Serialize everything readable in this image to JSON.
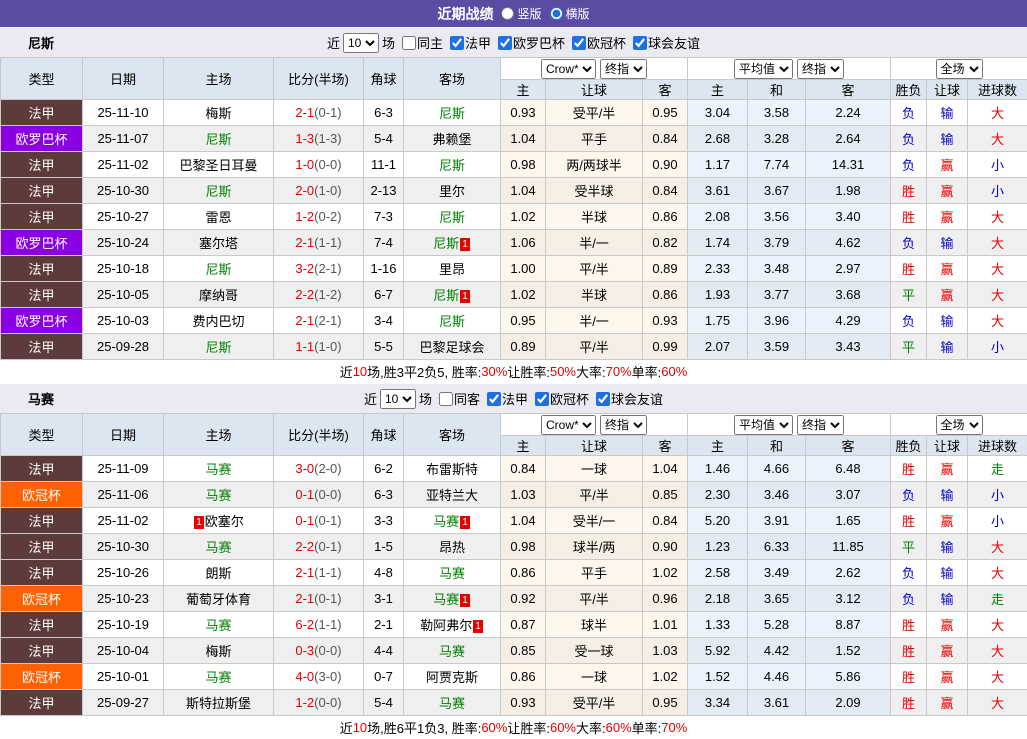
{
  "banner": {
    "title": "近期战绩",
    "vertical": "竖版",
    "horizontal": "横版"
  },
  "head": {
    "type": "类型",
    "date": "日期",
    "home": "主场",
    "score": "比分(半场)",
    "corner": "角球",
    "away": "客场",
    "h": "主",
    "rq": "让球",
    "a": "客",
    "draw": "和",
    "sf": "胜负",
    "goals": "进球数"
  },
  "dropdowns": {
    "crow": "Crow*",
    "final": "终指",
    "avg": "平均值",
    "full": "全场"
  },
  "filters_common": {
    "near": "近",
    "games": "场"
  },
  "colors": {
    "banner_bg": "#5b4ba2",
    "ligue1_bg": "#5e3b3b",
    "europa_bg": "#8b00e3",
    "ucl_bg": "#ff6000",
    "focus_team": "#008000",
    "score_red": "#e60000",
    "win_red": "#e60000",
    "draw_green": "#008000",
    "loss_blue": "#0000cc"
  },
  "sections": [
    {
      "team": "尼斯",
      "filter": {
        "count": "10",
        "same": "同主",
        "same_checked": false,
        "leagues": [
          "法甲",
          "欧罗巴杯",
          "欧冠杯",
          "球会友谊"
        ]
      },
      "rows": [
        {
          "lg": "法甲",
          "lc": "fa",
          "date": "25-11-10",
          "home": {
            "n": "梅斯"
          },
          "score": "2-1",
          "half": "(0-1)",
          "corner": "6-3",
          "away": {
            "n": "尼斯",
            "g": true
          },
          "o1": "0.93",
          "hd": "受平/半",
          "o2": "0.95",
          "a1": "3.04",
          "a2": "3.58",
          "a3": "2.24",
          "r1": {
            "t": "负",
            "c": "cb"
          },
          "r2": {
            "t": "输",
            "c": "cb"
          },
          "r3": {
            "t": "大",
            "c": "cr"
          }
        },
        {
          "lg": "欧罗巴杯",
          "lc": "ou",
          "date": "25-11-07",
          "home": {
            "n": "尼斯",
            "g": true
          },
          "score": "1-3",
          "half": "(1-3)",
          "corner": "5-4",
          "away": {
            "n": "弗赖堡"
          },
          "o1": "1.04",
          "hd": "平手",
          "o2": "0.84",
          "a1": "2.68",
          "a2": "3.28",
          "a3": "2.64",
          "r1": {
            "t": "负",
            "c": "cb"
          },
          "r2": {
            "t": "输",
            "c": "cb"
          },
          "r3": {
            "t": "大",
            "c": "cr"
          }
        },
        {
          "lg": "法甲",
          "lc": "fa",
          "date": "25-11-02",
          "home": {
            "n": "巴黎圣日耳曼"
          },
          "score": "1-0",
          "half": "(0-0)",
          "corner": "11-1",
          "away": {
            "n": "尼斯",
            "g": true
          },
          "o1": "0.98",
          "hd": "两/两球半",
          "o2": "0.90",
          "a1": "1.17",
          "a2": "7.74",
          "a3": "14.31",
          "r1": {
            "t": "负",
            "c": "cb"
          },
          "r2": {
            "t": "赢",
            "c": "cr"
          },
          "r3": {
            "t": "小",
            "c": "cb"
          }
        },
        {
          "lg": "法甲",
          "lc": "fa",
          "date": "25-10-30",
          "home": {
            "n": "尼斯",
            "g": true
          },
          "score": "2-0",
          "half": "(1-0)",
          "corner": "2-13",
          "away": {
            "n": "里尔"
          },
          "o1": "1.04",
          "hd": "受半球",
          "o2": "0.84",
          "a1": "3.61",
          "a2": "3.67",
          "a3": "1.98",
          "r1": {
            "t": "胜",
            "c": "cr"
          },
          "r2": {
            "t": "赢",
            "c": "cr"
          },
          "r3": {
            "t": "小",
            "c": "cb"
          }
        },
        {
          "lg": "法甲",
          "lc": "fa",
          "date": "25-10-27",
          "home": {
            "n": "雷恩"
          },
          "score": "1-2",
          "half": "(0-2)",
          "corner": "7-3",
          "away": {
            "n": "尼斯",
            "g": true
          },
          "o1": "1.02",
          "hd": "半球",
          "o2": "0.86",
          "a1": "2.08",
          "a2": "3.56",
          "a3": "3.40",
          "r1": {
            "t": "胜",
            "c": "cr"
          },
          "r2": {
            "t": "赢",
            "c": "cr"
          },
          "r3": {
            "t": "大",
            "c": "cr"
          }
        },
        {
          "lg": "欧罗巴杯",
          "lc": "ou",
          "date": "25-10-24",
          "home": {
            "n": "塞尔塔"
          },
          "score": "2-1",
          "half": "(1-1)",
          "corner": "7-4",
          "away": {
            "n": "尼斯",
            "g": true,
            "badge": "1"
          },
          "o1": "1.06",
          "hd": "半/一",
          "o2": "0.82",
          "a1": "1.74",
          "a2": "3.79",
          "a3": "4.62",
          "r1": {
            "t": "负",
            "c": "cb"
          },
          "r2": {
            "t": "输",
            "c": "cb"
          },
          "r3": {
            "t": "大",
            "c": "cr"
          }
        },
        {
          "lg": "法甲",
          "lc": "fa",
          "date": "25-10-18",
          "home": {
            "n": "尼斯",
            "g": true
          },
          "score": "3-2",
          "half": "(2-1)",
          "corner": "1-16",
          "away": {
            "n": "里昂"
          },
          "o1": "1.00",
          "hd": "平/半",
          "o2": "0.89",
          "a1": "2.33",
          "a2": "3.48",
          "a3": "2.97",
          "r1": {
            "t": "胜",
            "c": "cr"
          },
          "r2": {
            "t": "赢",
            "c": "cr"
          },
          "r3": {
            "t": "大",
            "c": "cr"
          }
        },
        {
          "lg": "法甲",
          "lc": "fa",
          "date": "25-10-05",
          "home": {
            "n": "摩纳哥"
          },
          "score": "2-2",
          "half": "(1-2)",
          "corner": "6-7",
          "away": {
            "n": "尼斯",
            "g": true,
            "badge": "1"
          },
          "o1": "1.02",
          "hd": "半球",
          "o2": "0.86",
          "a1": "1.93",
          "a2": "3.77",
          "a3": "3.68",
          "r1": {
            "t": "平",
            "c": "cg"
          },
          "r2": {
            "t": "赢",
            "c": "cr"
          },
          "r3": {
            "t": "大",
            "c": "cr"
          }
        },
        {
          "lg": "欧罗巴杯",
          "lc": "ou",
          "date": "25-10-03",
          "home": {
            "n": "费内巴切"
          },
          "score": "2-1",
          "half": "(2-1)",
          "corner": "3-4",
          "away": {
            "n": "尼斯",
            "g": true
          },
          "o1": "0.95",
          "hd": "半/一",
          "o2": "0.93",
          "a1": "1.75",
          "a2": "3.96",
          "a3": "4.29",
          "r1": {
            "t": "负",
            "c": "cb"
          },
          "r2": {
            "t": "输",
            "c": "cb"
          },
          "r3": {
            "t": "大",
            "c": "cr"
          }
        },
        {
          "lg": "法甲",
          "lc": "fa",
          "date": "25-09-28",
          "home": {
            "n": "尼斯",
            "g": true
          },
          "score": "1-1",
          "half": "(1-0)",
          "corner": "5-5",
          "away": {
            "n": "巴黎足球会"
          },
          "o1": "0.89",
          "hd": "平/半",
          "o2": "0.99",
          "a1": "2.07",
          "a2": "3.59",
          "a3": "3.43",
          "r1": {
            "t": "平",
            "c": "cg"
          },
          "r2": {
            "t": "输",
            "c": "cb"
          },
          "r3": {
            "t": "小",
            "c": "cb"
          }
        }
      ],
      "summary": [
        {
          "t": "近"
        },
        {
          "t": "10",
          "r": true
        },
        {
          "t": "场,胜3平2负5, 胜率:"
        },
        {
          "t": "30%",
          "r": true
        },
        {
          "t": " 让胜率:"
        },
        {
          "t": "50%",
          "r": true
        },
        {
          "t": " 大率:"
        },
        {
          "t": "70%",
          "r": true
        },
        {
          "t": " 单率:"
        },
        {
          "t": "60%",
          "r": true
        }
      ]
    },
    {
      "team": "马赛",
      "filter": {
        "count": "10",
        "same": "同客",
        "same_checked": false,
        "leagues": [
          "法甲",
          "欧冠杯",
          "球会友谊"
        ]
      },
      "rows": [
        {
          "lg": "法甲",
          "lc": "fa",
          "date": "25-11-09",
          "home": {
            "n": "马赛",
            "g": true
          },
          "score": "3-0",
          "half": "(2-0)",
          "corner": "6-2",
          "away": {
            "n": "布雷斯特"
          },
          "o1": "0.84",
          "hd": "一球",
          "o2": "1.04",
          "a1": "1.46",
          "a2": "4.66",
          "a3": "6.48",
          "r1": {
            "t": "胜",
            "c": "cr"
          },
          "r2": {
            "t": "赢",
            "c": "cr"
          },
          "r3": {
            "t": "走",
            "c": "cg"
          }
        },
        {
          "lg": "欧冠杯",
          "lc": "oc",
          "date": "25-11-06",
          "home": {
            "n": "马赛",
            "g": true
          },
          "score": "0-1",
          "half": "(0-0)",
          "corner": "6-3",
          "away": {
            "n": "亚特兰大"
          },
          "o1": "1.03",
          "hd": "平/半",
          "o2": "0.85",
          "a1": "2.30",
          "a2": "3.46",
          "a3": "3.07",
          "r1": {
            "t": "负",
            "c": "cb"
          },
          "r2": {
            "t": "输",
            "c": "cb"
          },
          "r3": {
            "t": "小",
            "c": "cb"
          }
        },
        {
          "lg": "法甲",
          "lc": "fa",
          "date": "25-11-02",
          "home": {
            "n": "欧塞尔",
            "pre": "1"
          },
          "score": "0-1",
          "half": "(0-1)",
          "corner": "3-3",
          "away": {
            "n": "马赛",
            "g": true,
            "badge": "1"
          },
          "o1": "1.04",
          "hd": "受半/一",
          "o2": "0.84",
          "a1": "5.20",
          "a2": "3.91",
          "a3": "1.65",
          "r1": {
            "t": "胜",
            "c": "cr"
          },
          "r2": {
            "t": "赢",
            "c": "cr"
          },
          "r3": {
            "t": "小",
            "c": "cb"
          }
        },
        {
          "lg": "法甲",
          "lc": "fa",
          "date": "25-10-30",
          "home": {
            "n": "马赛",
            "g": true
          },
          "score": "2-2",
          "half": "(0-1)",
          "corner": "1-5",
          "away": {
            "n": "昂热"
          },
          "o1": "0.98",
          "hd": "球半/两",
          "o2": "0.90",
          "a1": "1.23",
          "a2": "6.33",
          "a3": "11.85",
          "r1": {
            "t": "平",
            "c": "cg"
          },
          "r2": {
            "t": "输",
            "c": "cb"
          },
          "r3": {
            "t": "大",
            "c": "cr"
          }
        },
        {
          "lg": "法甲",
          "lc": "fa",
          "date": "25-10-26",
          "home": {
            "n": "朗斯"
          },
          "score": "2-1",
          "half": "(1-1)",
          "corner": "4-8",
          "away": {
            "n": "马赛",
            "g": true
          },
          "o1": "0.86",
          "hd": "平手",
          "o2": "1.02",
          "a1": "2.58",
          "a2": "3.49",
          "a3": "2.62",
          "r1": {
            "t": "负",
            "c": "cb"
          },
          "r2": {
            "t": "输",
            "c": "cb"
          },
          "r3": {
            "t": "大",
            "c": "cr"
          }
        },
        {
          "lg": "欧冠杯",
          "lc": "oc",
          "date": "25-10-23",
          "home": {
            "n": "葡萄牙体育"
          },
          "score": "2-1",
          "half": "(0-1)",
          "corner": "3-1",
          "away": {
            "n": "马赛",
            "g": true,
            "badge": "1"
          },
          "o1": "0.92",
          "hd": "平/半",
          "o2": "0.96",
          "a1": "2.18",
          "a2": "3.65",
          "a3": "3.12",
          "r1": {
            "t": "负",
            "c": "cb"
          },
          "r2": {
            "t": "输",
            "c": "cb"
          },
          "r3": {
            "t": "走",
            "c": "cg"
          }
        },
        {
          "lg": "法甲",
          "lc": "fa",
          "date": "25-10-19",
          "home": {
            "n": "马赛",
            "g": true
          },
          "score": "6-2",
          "half": "(1-1)",
          "corner": "2-1",
          "away": {
            "n": "勒阿弗尔",
            "badge": "1"
          },
          "o1": "0.87",
          "hd": "球半",
          "o2": "1.01",
          "a1": "1.33",
          "a2": "5.28",
          "a3": "8.87",
          "r1": {
            "t": "胜",
            "c": "cr"
          },
          "r2": {
            "t": "赢",
            "c": "cr"
          },
          "r3": {
            "t": "大",
            "c": "cr"
          }
        },
        {
          "lg": "法甲",
          "lc": "fa",
          "date": "25-10-04",
          "home": {
            "n": "梅斯"
          },
          "score": "0-3",
          "half": "(0-0)",
          "corner": "4-4",
          "away": {
            "n": "马赛",
            "g": true
          },
          "o1": "0.85",
          "hd": "受一球",
          "o2": "1.03",
          "a1": "5.92",
          "a2": "4.42",
          "a3": "1.52",
          "r1": {
            "t": "胜",
            "c": "cr"
          },
          "r2": {
            "t": "赢",
            "c": "cr"
          },
          "r3": {
            "t": "大",
            "c": "cr"
          }
        },
        {
          "lg": "欧冠杯",
          "lc": "oc",
          "date": "25-10-01",
          "home": {
            "n": "马赛",
            "g": true
          },
          "score": "4-0",
          "half": "(3-0)",
          "corner": "0-7",
          "away": {
            "n": "阿贾克斯"
          },
          "o1": "0.86",
          "hd": "一球",
          "o2": "1.02",
          "a1": "1.52",
          "a2": "4.46",
          "a3": "5.86",
          "r1": {
            "t": "胜",
            "c": "cr"
          },
          "r2": {
            "t": "赢",
            "c": "cr"
          },
          "r3": {
            "t": "大",
            "c": "cr"
          }
        },
        {
          "lg": "法甲",
          "lc": "fa",
          "date": "25-09-27",
          "home": {
            "n": "斯特拉斯堡"
          },
          "score": "1-2",
          "half": "(0-0)",
          "corner": "5-4",
          "away": {
            "n": "马赛",
            "g": true
          },
          "o1": "0.93",
          "hd": "受平/半",
          "o2": "0.95",
          "a1": "3.34",
          "a2": "3.61",
          "a3": "2.09",
          "r1": {
            "t": "胜",
            "c": "cr"
          },
          "r2": {
            "t": "赢",
            "c": "cr"
          },
          "r3": {
            "t": "大",
            "c": "cr"
          }
        }
      ],
      "summary": [
        {
          "t": "近"
        },
        {
          "t": "10",
          "r": true
        },
        {
          "t": "场,胜6平1负3, 胜率:"
        },
        {
          "t": "60%",
          "r": true
        },
        {
          "t": " 让胜率:"
        },
        {
          "t": "60%",
          "r": true
        },
        {
          "t": " 大率:"
        },
        {
          "t": "60%",
          "r": true
        },
        {
          "t": " 单率:"
        },
        {
          "t": "70%",
          "r": true
        }
      ]
    }
  ]
}
